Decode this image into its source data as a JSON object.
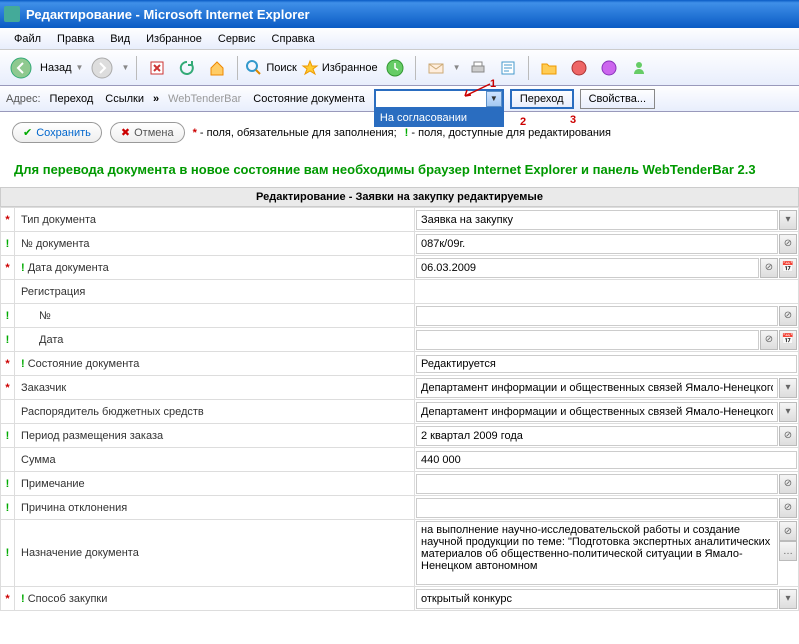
{
  "window": {
    "title": "Редактирование - Microsoft Internet Explorer"
  },
  "menu": {
    "file": "Файл",
    "edit": "Правка",
    "view": "Вид",
    "fav": "Избранное",
    "tools": "Сервис",
    "help": "Справка"
  },
  "tb": {
    "back": "Назад",
    "search": "Поиск",
    "fav": "Избранное"
  },
  "addr": {
    "address": "Адрес:",
    "go": "Переход",
    "links": "Ссылки",
    "webtender": "WebTenderBar",
    "state_lbl": "Состояние документа",
    "state_dd_open": "На согласовании",
    "go_btn": "Переход",
    "props_btn": "Свойства...",
    "annot1": "1",
    "annot2": "2",
    "annot3": "3"
  },
  "actions": {
    "save": "Сохранить",
    "cancel": "Отмена",
    "legend_req": "- поля, обязательные для заполнения;",
    "legend_edit": "- поля, доступные для редактирования"
  },
  "notice": "Для перевода документа в новое состояние вам необходимы браузер Internet Explorer и панель WebTenderBar 2.3",
  "section": "Редактирование - Заявки на закупку редактируемые",
  "form": {
    "doc_type": {
      "label": "Тип документа",
      "value": "Заявка на закупку"
    },
    "doc_no": {
      "label": "№ документа",
      "value": "087к/09г."
    },
    "doc_date": {
      "label": "Дата документа",
      "value": "06.03.2009"
    },
    "reg": {
      "label": "Регистрация"
    },
    "reg_no": {
      "label": "№",
      "value": ""
    },
    "reg_date": {
      "label": "Дата",
      "value": ""
    },
    "state": {
      "label": "Состояние документа",
      "value": "Редактируется"
    },
    "customer": {
      "label": "Заказчик",
      "value": "Департамент информации и общественных связей Ямало-Ненецкого авт"
    },
    "budget_mgr": {
      "label": "Распорядитель бюджетных средств",
      "value": "Департамент информации и общественных связей Ямало-Ненецкого авт"
    },
    "period": {
      "label": "Период размещения заказа",
      "value": "2 квартал 2009 года"
    },
    "sum": {
      "label": "Сумма",
      "value": "440 000"
    },
    "note": {
      "label": "Примечание",
      "value": ""
    },
    "reject": {
      "label": "Причина отклонения",
      "value": ""
    },
    "purpose": {
      "label": "Назначение документа",
      "value": "на выполнение научно-исследовательской работы и создание научной продукции по теме: \"Подготовка экспертных аналитических материалов об общественно-политической ситуации в Ямало-Ненецком автономном"
    },
    "method": {
      "label": "Способ закупки",
      "value": "открытый конкурс"
    }
  }
}
